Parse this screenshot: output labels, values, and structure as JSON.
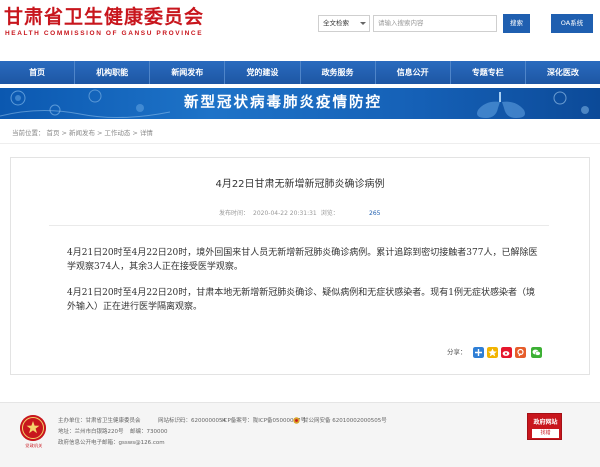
{
  "header": {
    "logo_cn": "甘肃省卫生健康委员会",
    "logo_en": "HEALTH COMMISSION OF GANSU PROVINCE",
    "search_scope": "全文检索",
    "search_placeholder": "请输入搜索内容",
    "search_button": "搜索",
    "oa_button": "OA系统"
  },
  "nav": {
    "items": [
      "首页",
      "机构职能",
      "新闻发布",
      "党的建设",
      "政务服务",
      "信息公开",
      "专题专栏",
      "深化医改"
    ]
  },
  "banner": {
    "title": "新型冠状病毒肺炎疫情防控"
  },
  "breadcrumb": {
    "label": "当前位置：",
    "items": [
      "首页",
      "新闻发布",
      "工作动态",
      "详情"
    ],
    "separator": ">"
  },
  "article": {
    "title": "4月22日甘肃无新增新冠肺炎确诊病例",
    "publish_label": "发布时间：",
    "publish_time": "2020-04-22 20:31:31",
    "views_label": "浏览：",
    "views": "265",
    "paragraph1": "4月21日20时至4月22日20时，境外回国来甘人员无新增新冠肺炎确诊病例。累计追踪到密切接触者377人，已解除医学观察374人，其余3人正在接受医学观察。",
    "paragraph2": "4月21日20时至4月22日20时，甘肃本地无新增新冠肺炎确诊、疑似病例和无症状感染者。现有1例无症状感染者（境外输入）正在进行医学隔离观察。",
    "share_label": "分享："
  },
  "footer": {
    "sponsor": "主办单位：甘肃省卫生健康委员会",
    "site_code": "网站标识码：6200000054",
    "icp": "ICP备案号：陇ICP备05000097号",
    "police": "甘公网安备 62010002000505号",
    "address": "地址：兰州市白银路220号",
    "zip": "邮编：730000",
    "email": "政府信息公开电子邮箱：gssws@126.com",
    "seal_text": "党政机关",
    "gov_badge_title": "政府网站",
    "gov_badge_sub": "找错"
  },
  "colors": {
    "brand_red": "#c8161d",
    "nav_blue": "#1d56a3",
    "button_blue": "#1f5fb0"
  }
}
